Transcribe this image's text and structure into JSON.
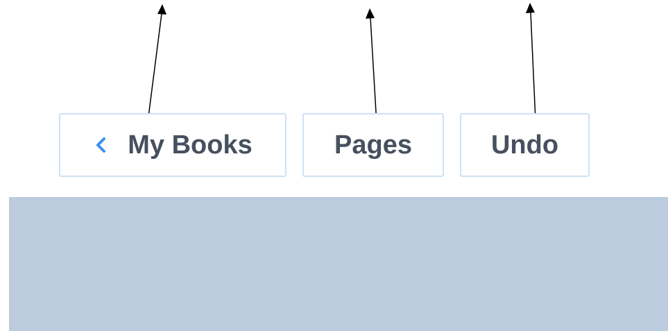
{
  "toolbar": {
    "my_books_label": "My Books",
    "pages_label": "Pages",
    "undo_label": "Undo"
  },
  "icons": {
    "back": "chevron-left-icon",
    "annotation": "arrow-pointer"
  },
  "colors": {
    "button_text": "#46505e",
    "button_border": "#cfe0f7",
    "chevron": "#3b8ff0",
    "panel": "#bccbde",
    "arrow": "#000000"
  }
}
